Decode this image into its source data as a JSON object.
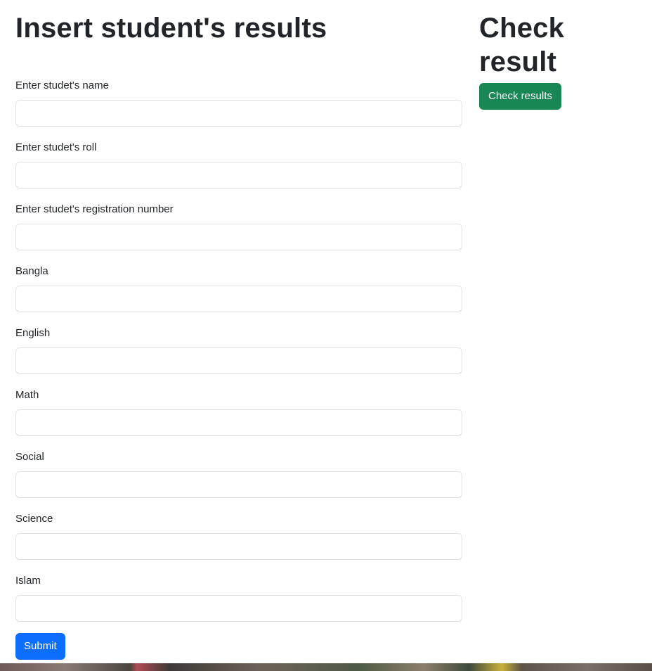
{
  "insert": {
    "title": "Insert student's results",
    "fields": [
      {
        "label": "Enter studet's name",
        "value": ""
      },
      {
        "label": "Enter studet's roll",
        "value": ""
      },
      {
        "label": "Enter studet's registration number",
        "value": ""
      },
      {
        "label": "Bangla",
        "value": ""
      },
      {
        "label": "English",
        "value": ""
      },
      {
        "label": "Math",
        "value": ""
      },
      {
        "label": "Social",
        "value": ""
      },
      {
        "label": "Science",
        "value": ""
      },
      {
        "label": "Islam",
        "value": ""
      }
    ],
    "submit_label": "Submit"
  },
  "check": {
    "title": "Check result",
    "button_label": "Check results"
  },
  "colors": {
    "primary": "#0d6efd",
    "success": "#198754",
    "text": "#212529",
    "input_border": "#dee2e6"
  }
}
